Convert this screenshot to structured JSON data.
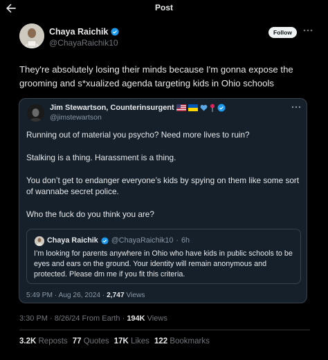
{
  "header": {
    "title": "Post"
  },
  "post": {
    "author_name": "Chaya Raichik",
    "author_handle": "@ChayaRaichik10",
    "follow_label": "Follow",
    "text": "They're absolutely losing their minds because I'm gonna expose the grooming and s*xualized agenda targeting kids in Ohio schools",
    "time": "3:30 PM",
    "date": "8/26/24",
    "source": "From Earth",
    "views_count": "194K",
    "views_label": "Views",
    "stats": {
      "reposts_count": "3.2K",
      "reposts_label": "Reposts",
      "quotes_count": "77",
      "quotes_label": "Quotes",
      "likes_count": "17K",
      "likes_label": "Likes",
      "bookmarks_count": "122",
      "bookmarks_label": "Bookmarks"
    }
  },
  "quote": {
    "author_name": "Jim Stewartson, Counterinsurgent",
    "author_handle": "@jimstewartson",
    "paragraphs": [
      "Running out of material you psycho? Need more lives to ruin?",
      "Stalking is a thing. Harassment is a thing.",
      "You don’t get to endanger everyone’s kids by spying on them like some sort of wannabe secret police.",
      "Who the fuck do you think you are?"
    ],
    "time": "5:49 PM",
    "date": "Aug 26, 2024",
    "views_count": "2,747",
    "views_label": "Views"
  },
  "nested_quote": {
    "author_name": "Chaya Raichik",
    "author_handle": "@ChayaRaichik10",
    "age": "6h",
    "text": "I’m looking for parents anywhere in Ohio who have kids in public schools to be eyes and ears on the ground. Your identity will remain anonymous and protected. Please dm me if you fit this criteria."
  },
  "colors": {
    "background": "#000000",
    "card": "#15202b",
    "verified": "#1d9bf0",
    "muted": "#71767b"
  },
  "icons": [
    "back-arrow-icon",
    "verified-badge-icon",
    "more-icon",
    "us-flag-icon",
    "ukraine-flag-icon",
    "blue-heart-icon",
    "pin-icon"
  ]
}
